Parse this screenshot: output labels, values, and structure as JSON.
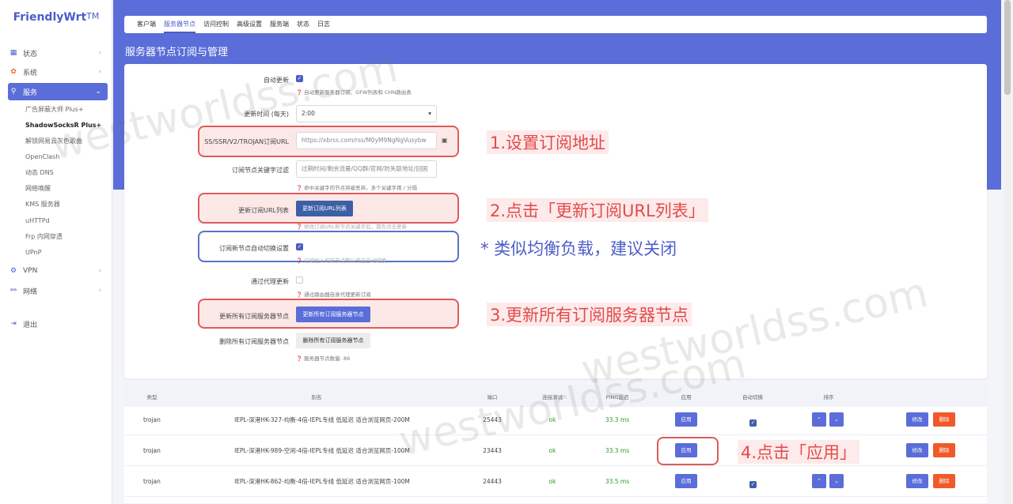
{
  "brand": {
    "name": "FriendlyWrt",
    "tm": "TM"
  },
  "sidebar": {
    "items": [
      {
        "label": "状态",
        "icon": "dashboard-icon"
      },
      {
        "label": "系统",
        "icon": "gear-icon"
      },
      {
        "label": "服务",
        "icon": "link-icon"
      },
      {
        "label": "VPN",
        "icon": "vpn-icon"
      },
      {
        "label": "网络",
        "icon": "network-icon"
      },
      {
        "label": "退出",
        "icon": "logout-icon"
      }
    ],
    "sub_items": [
      "广告屏蔽大师 Plus+",
      "ShadowSocksR Plus+",
      "解锁网易云灰色歌曲",
      "OpenClash",
      "动态 DNS",
      "网络唤醒",
      "KMS 服务器",
      "uHTTPd",
      "Frp 内网穿透",
      "UPnP"
    ]
  },
  "tabs": [
    "客户端",
    "服务器节点",
    "访问控制",
    "高级设置",
    "服务端",
    "状态",
    "日志"
  ],
  "page_title": "服务器节点订阅与管理",
  "form": {
    "auto_update_label": "自动更新",
    "auto_update_hint": "自动更新服务器订阅、GFW列表和 CHN路由表",
    "update_time_label": "更新时间 (每天)",
    "update_time_value": "2:00",
    "sub_url_label": "SS/SSR/V2/TROJAN订阅URL",
    "sub_url_value": "https://xbrss.com/rss/M0yM9NgNgVusybw",
    "keyword_label": "订阅节点关键字过滤",
    "keyword_placeholder": "过期时间/剩余流量/QQ群/官网/防失联地址/回国",
    "keyword_hint": "命中关键字的节点将被丢弃。多个关键字用 / 分隔",
    "update_url_label": "更新订阅URL列表",
    "update_url_button": "更新订阅URL列表",
    "update_url_hint": "修改订阅URL和节点关键字后，需先点击更新",
    "auto_switch_label": "订阅新节点自动切换设置",
    "auto_switch_hint": "订阅加入的新节点默认开启自动切换",
    "proxy_update_label": "通过代理更新",
    "proxy_update_hint": "通过路由器自身代理更新订阅",
    "update_all_label": "更新所有订阅服务器节点",
    "update_all_button": "更新所有订阅服务器节点",
    "delete_all_label": "删除所有订阅服务器节点",
    "delete_all_button": "删除所有订阅服务器节点",
    "node_count_hint": "服务器节点数量: 86"
  },
  "annotations": {
    "step1": "1.设置订阅地址",
    "step2": "2.点击「更新订阅URL列表」",
    "note": "* 类似均衡负载，建议关闭",
    "step3": "3.更新所有订阅服务器节点",
    "step4": "4.点击「应用」"
  },
  "table": {
    "headers": [
      "类型",
      "别名",
      "端口",
      "连接测试",
      "PING延迟",
      "应用",
      "自动切换",
      "排序"
    ],
    "apply_label": "应用",
    "edit_label": "修改",
    "delete_label": "删除",
    "rows": [
      {
        "type": "trojan",
        "alias": "IEPL-深港HK-327-均衡-4倍-IEPL专线 低延迟 适合浏览网页-200M",
        "port": "25443",
        "test": "ok",
        "ping": "33.3 ms"
      },
      {
        "type": "trojan",
        "alias": "IEPL-深港HK-989-空闲-4倍-IEPL专线 低延迟 适合浏览网页-100M",
        "port": "23443",
        "test": "ok",
        "ping": "33.3 ms"
      },
      {
        "type": "trojan",
        "alias": "IEPL-深港HK-862-均衡-4倍-IEPL专线 低延迟 适合浏览网页-100M",
        "port": "24443",
        "test": "ok",
        "ping": "33.5 ms"
      }
    ]
  },
  "watermark": "westworldss.com",
  "colors": {
    "accent": "#5a6dd8",
    "annotation": "#e34b4b",
    "ok": "#2a9d2a",
    "danger": "#f05a2a"
  }
}
